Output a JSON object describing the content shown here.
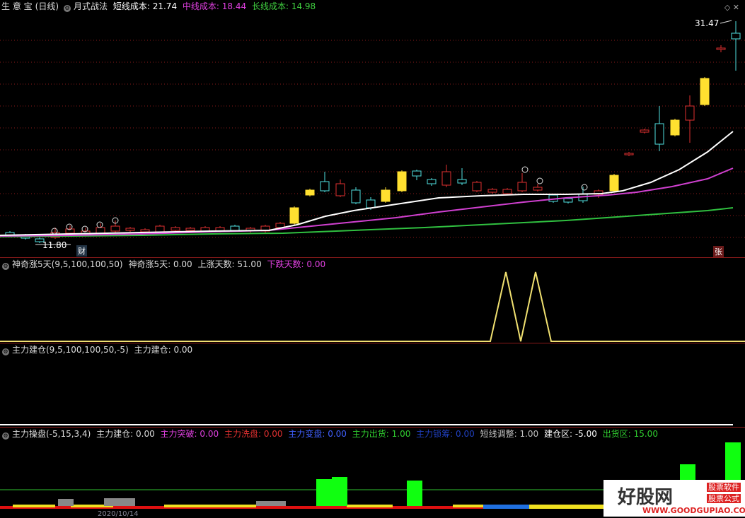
{
  "app": {
    "brand": "生 意 宝",
    "period": "(日线)",
    "indicator_name": "月式战法"
  },
  "main": {
    "short_cost_label": "短线成本: ",
    "short_cost": "21.74",
    "mid_cost_label": "中线成本: ",
    "mid_cost": "18.44",
    "long_cost_label": "长线成本: ",
    "long_cost": "14.98",
    "high_price": "31.47",
    "low_price": "11.80",
    "cai_tag": "财",
    "zhang_tag": "张",
    "markers": [
      "①",
      "②",
      "③",
      "④",
      "⑤"
    ],
    "colors": {
      "short": "#ffffff",
      "mid": "#e040e0",
      "long": "#40c040"
    }
  },
  "panel2": {
    "title": "神奇涨5天(9,5,100,100,50)",
    "v1_label": "神奇涨5天: ",
    "v1": "0.00",
    "v2_label": "上涨天数: ",
    "v2": "51.00",
    "v3_label": "下跌天数: ",
    "v3": "0.00"
  },
  "panel3": {
    "title": "主力建仓(9,5,100,100,50,-5)",
    "v1_label": "主力建仓: ",
    "v1": "0.00"
  },
  "panel4": {
    "title": "主力操盘(-5,15,3,4)",
    "items": [
      {
        "label": "主力建仓: ",
        "value": "0.00",
        "color": "#dddddd"
      },
      {
        "label": "主力突破: ",
        "value": "0.00",
        "color": "#e040e0"
      },
      {
        "label": "主力洗盘: ",
        "value": "0.00",
        "color": "#e03030"
      },
      {
        "label": "主力变盘: ",
        "value": "0.00",
        "color": "#4060ff"
      },
      {
        "label": "主力出货: ",
        "value": "1.00",
        "color": "#30d030"
      },
      {
        "label": "主力锁筹: ",
        "value": "0.00",
        "color": "#2040c0"
      },
      {
        "label": "短线调整: ",
        "value": "1.00",
        "color": "#c0c0c0"
      },
      {
        "label": "建仓区: ",
        "value": "-5.00",
        "color": "#ffffff"
      },
      {
        "label": "出货区: ",
        "value": "15.00",
        "color": "#30d030"
      }
    ],
    "date_label": "2020/10/14"
  },
  "watermark": {
    "big": "好股网",
    "tag1": "股票软件",
    "tag2": "股票公式",
    "url": "WWW.GOODGUPIAO.COM"
  }
}
